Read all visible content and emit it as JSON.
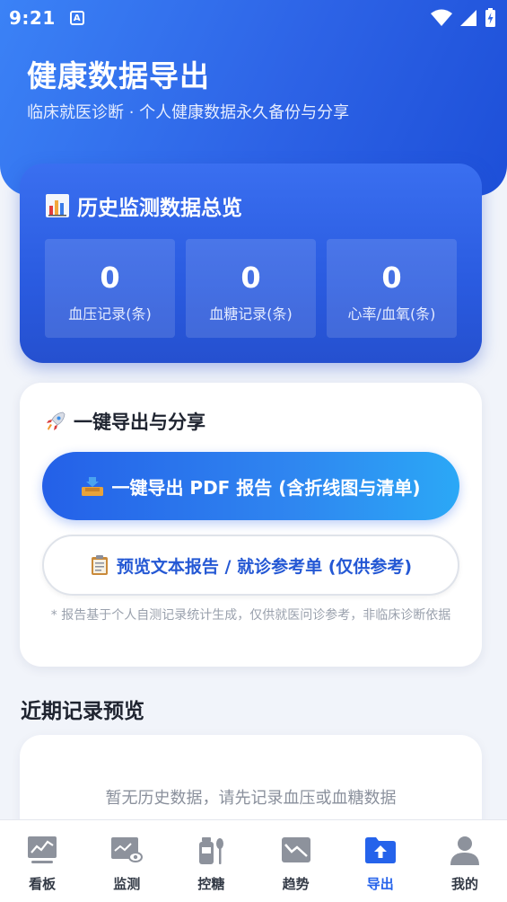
{
  "status_bar": {
    "time": "9:21",
    "app_badge": "A"
  },
  "header": {
    "title": "健康数据导出",
    "subtitle": "临床就医诊断 · 个人健康数据永久备份与分享"
  },
  "overview": {
    "title": "历史监测数据总览",
    "icon": "bar-chart-icon",
    "stats": [
      {
        "value": "0",
        "label": "血压记录(条)"
      },
      {
        "value": "0",
        "label": "血糖记录(条)"
      },
      {
        "value": "0",
        "label": "心率/血氧(条)"
      }
    ]
  },
  "export": {
    "title": "一键导出与分享",
    "icon": "rocket-icon",
    "primary_button": "一键导出 PDF 报告 (含折线图与清单)",
    "primary_icon": "inbox-tray-icon",
    "secondary_button": "预览文本报告 / 就诊参考单 (仅供参考)",
    "secondary_icon": "clipboard-icon",
    "note": "* 报告基于个人自测记录统计生成，仅供就医问诊参考，非临床诊断依据"
  },
  "recent": {
    "title": "近期记录预览",
    "empty_text": "暂无历史数据，请先记录血压或血糖数据"
  },
  "bottom_nav": {
    "active_index": 4,
    "active_color": "#2563eb",
    "items": [
      {
        "label": "看板",
        "icon": "dashboard-icon"
      },
      {
        "label": "监测",
        "icon": "monitor-icon"
      },
      {
        "label": "控糖",
        "icon": "food-icon"
      },
      {
        "label": "趋势",
        "icon": "trend-icon"
      },
      {
        "label": "导出",
        "icon": "upload-folder-icon"
      },
      {
        "label": "我的",
        "icon": "profile-icon"
      }
    ]
  },
  "colors": {
    "primary": "#2563eb",
    "hero_start": "#3b82f6",
    "hero_end": "#1d4fd8",
    "background": "#f1f4fa"
  }
}
